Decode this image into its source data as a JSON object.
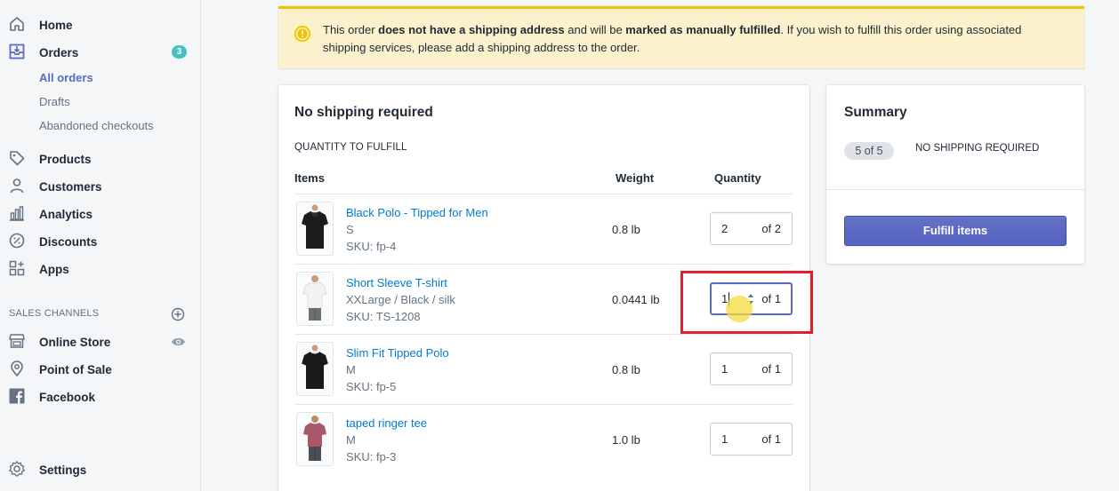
{
  "sidebar": {
    "home": "Home",
    "orders": "Orders",
    "orders_badge": "3",
    "all_orders": "All orders",
    "drafts": "Drafts",
    "abandoned": "Abandoned checkouts",
    "products": "Products",
    "customers": "Customers",
    "analytics": "Analytics",
    "discounts": "Discounts",
    "apps": "Apps",
    "sales_channels_title": "SALES CHANNELS",
    "online_store": "Online Store",
    "point_of_sale": "Point of Sale",
    "facebook": "Facebook",
    "settings": "Settings"
  },
  "banner": {
    "part1": "This order ",
    "bold1": "does not have a shipping address",
    "part2": " and will be ",
    "bold2": "marked as manually fulfilled",
    "part3": ". If you wish to fulfill this order using associated shipping services, please add a shipping address to the order."
  },
  "main": {
    "title": "No shipping required",
    "subhead": "QUANTITY TO FULFILL",
    "col_items": "Items",
    "col_weight": "Weight",
    "col_quantity": "Quantity",
    "items": [
      {
        "name": "Black Polo - Tipped for Men",
        "variant": "S",
        "sku": "SKU: fp-4",
        "weight": "0.8 lb",
        "qty": "2",
        "of": "of 2"
      },
      {
        "name": "Short Sleeve T-shirt",
        "variant": "XXLarge / Black / silk",
        "sku": "SKU: TS-1208",
        "weight": "0.0441 lb",
        "qty": "1",
        "of": "of 1"
      },
      {
        "name": "Slim Fit Tipped Polo",
        "variant": "M",
        "sku": "SKU: fp-5",
        "weight": "0.8 lb",
        "qty": "1",
        "of": "of 1"
      },
      {
        "name": "taped ringer tee",
        "variant": "M",
        "sku": "SKU: fp-3",
        "weight": "1.0 lb",
        "qty": "1",
        "of": "of 1"
      }
    ]
  },
  "summary": {
    "title": "Summary",
    "count": "5 of 5",
    "status": "NO SHIPPING REQUIRED",
    "button": "Fulfill items"
  },
  "colors": {
    "accent": "#5c6ac4",
    "link": "#007ace",
    "banner_bg": "#fcf1cd",
    "banner_border": "#eec200",
    "highlight": "#e0202c",
    "badge": "#47c1bf"
  }
}
